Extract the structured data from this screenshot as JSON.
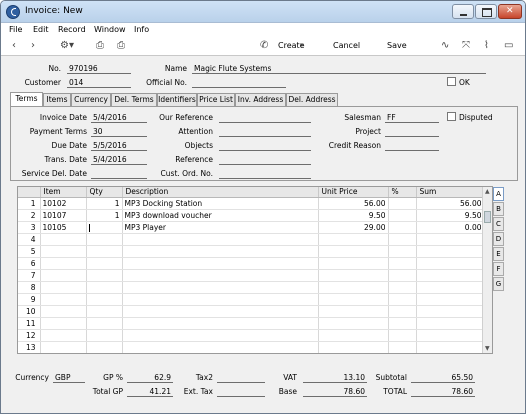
{
  "window": {
    "title": "Invoice: New"
  },
  "menu": [
    "File",
    "Edit",
    "Record",
    "Window",
    "Info"
  ],
  "toolbar": {
    "create": "Create",
    "cancel": "Cancel",
    "save": "Save"
  },
  "header": {
    "no_label": "No.",
    "no_value": "970196",
    "name_label": "Name",
    "name_value": "Magic Flute Systems",
    "customer_label": "Customer",
    "customer_value": "014",
    "official_label": "Official No.",
    "official_value": "",
    "ok_label": "OK"
  },
  "tabs": [
    "Terms",
    "Items",
    "Currency",
    "Del. Terms",
    "Identifiers",
    "Price List",
    "Inv. Address",
    "Del. Address"
  ],
  "terms": {
    "invoice_date_label": "Invoice Date",
    "invoice_date": "5/4/2016",
    "payment_terms_label": "Payment Terms",
    "payment_terms": "30",
    "due_date_label": "Due Date",
    "due_date": "5/5/2016",
    "trans_date_label": "Trans. Date",
    "trans_date": "5/4/2016",
    "service_del_label": "Service Del. Date",
    "service_del": "",
    "our_ref_label": "Our Reference",
    "our_ref": "",
    "attention_label": "Attention",
    "attention": "",
    "objects_label": "Objects",
    "objects": "",
    "reference_label": "Reference",
    "reference": "",
    "cust_ord_label": "Cust. Ord. No.",
    "cust_ord": "",
    "salesman_label": "Salesman",
    "salesman": "FF",
    "project_label": "Project",
    "project": "",
    "credit_reason_label": "Credit Reason",
    "credit_reason": "",
    "disputed_label": "Disputed"
  },
  "grid": {
    "columns": [
      "",
      "Item",
      "Qty",
      "Description",
      "Unit Price",
      "%",
      "Sum"
    ],
    "rows": [
      [
        "1",
        "10102",
        "1",
        "MP3 Docking Station",
        "56.00",
        "",
        "56.00"
      ],
      [
        "2",
        "10107",
        "1",
        "MP3 download voucher",
        "9.50",
        "",
        "9.50"
      ],
      [
        "3",
        "10105",
        "",
        "MP3 Player",
        "29.00",
        "",
        "0.00"
      ],
      [
        "4",
        "",
        "",
        "",
        "",
        "",
        ""
      ],
      [
        "5",
        "",
        "",
        "",
        "",
        "",
        ""
      ],
      [
        "6",
        "",
        "",
        "",
        "",
        "",
        ""
      ],
      [
        "7",
        "",
        "",
        "",
        "",
        "",
        ""
      ],
      [
        "8",
        "",
        "",
        "",
        "",
        "",
        ""
      ],
      [
        "9",
        "",
        "",
        "",
        "",
        "",
        ""
      ],
      [
        "10",
        "",
        "",
        "",
        "",
        "",
        ""
      ],
      [
        "11",
        "",
        "",
        "",
        "",
        "",
        ""
      ],
      [
        "12",
        "",
        "",
        "",
        "",
        "",
        ""
      ],
      [
        "13",
        "",
        "",
        "",
        "",
        "",
        ""
      ]
    ]
  },
  "side_tabs": [
    "A",
    "B",
    "C",
    "D",
    "E",
    "F",
    "G"
  ],
  "footer": {
    "currency_label": "Currency",
    "currency": "GBP",
    "gp_pct_label": "GP %",
    "gp_pct": "62.9",
    "total_gp_label": "Total GP",
    "total_gp": "41.21",
    "tax2_label": "Tax2",
    "tax2": "",
    "ext_tax_label": "Ext. Tax",
    "ext_tax": "",
    "vat_label": "VAT",
    "vat": "13.10",
    "base_label": "Base",
    "base": "78.60",
    "subtotal_label": "Subtotal",
    "subtotal": "65.50",
    "total_label": "TOTAL",
    "total": "78.60"
  }
}
